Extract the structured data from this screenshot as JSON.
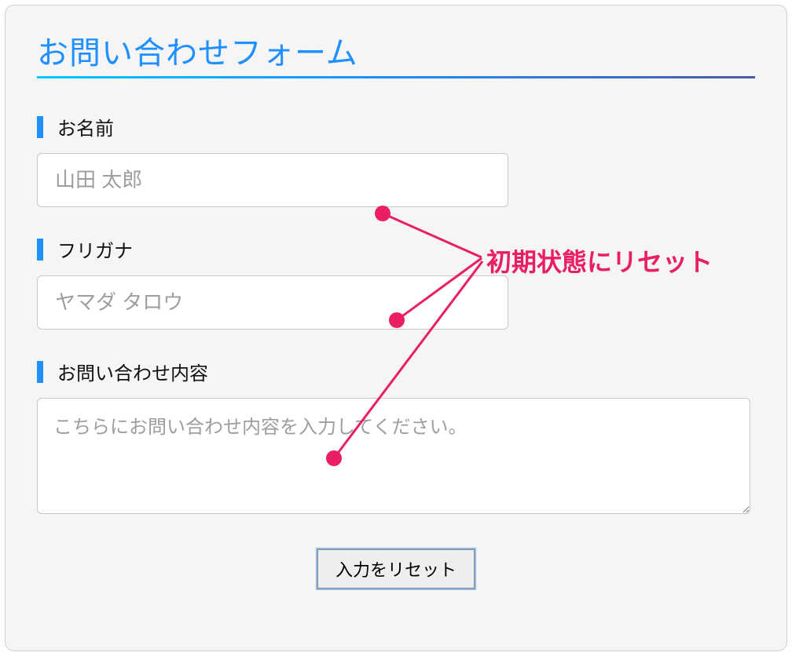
{
  "title": "お問い合わせフォーム",
  "fields": {
    "name": {
      "label": "お名前",
      "placeholder": "山田 太郎"
    },
    "kana": {
      "label": "フリガナ",
      "placeholder": "ヤマダ タロウ"
    },
    "body": {
      "label": "お問い合わせ内容",
      "placeholder": "こちらにお問い合わせ内容を入力してください。"
    }
  },
  "reset_button": "入力をリセット",
  "annotation": {
    "text": "初期状態にリセット"
  }
}
